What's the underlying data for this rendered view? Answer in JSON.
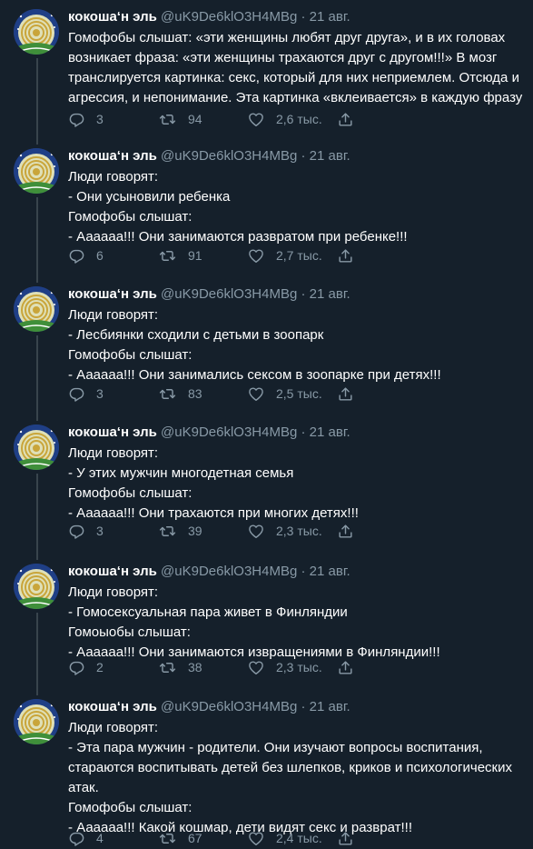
{
  "colors": {
    "background": "#15202b",
    "text": "#ffffff",
    "muted": "#8899a6",
    "thread_line": "#38444d"
  },
  "tweets": [
    {
      "author": "кокоша‘н эль",
      "handle": "@uK9De6klO3H4MBg",
      "separator": "·",
      "date": "21 авг.",
      "lines": [
        "Гомофобы слышат: «эти женщины любят друг друга», и в их головах возникает фраза: «эти женщины трахаются друг с другом!!!» В мозг транслируется картинка: секс, который для них неприемлем. Отсюда и агрессия, и непонимание. Эта картинка «вклеивается» в каждую фразу"
      ],
      "replies": "3",
      "retweets": "94",
      "likes": "2,6 тыс."
    },
    {
      "author": "кокоша‘н эль",
      "handle": "@uK9De6klO3H4MBg",
      "separator": "·",
      "date": "21 авг.",
      "lines": [
        "Люди говорят:",
        "- Они усыновили ребенка",
        "Гомофобы слышат:",
        "- Аааааа!!! Они занимаются развратом при ребенке!!!"
      ],
      "replies": "6",
      "retweets": "91",
      "likes": "2,7 тыс."
    },
    {
      "author": "кокоша‘н эль",
      "handle": "@uK9De6klO3H4MBg",
      "separator": "·",
      "date": "21 авг.",
      "lines": [
        "Люди говорят:",
        "- Лесбиянки сходили с детьми в зоопарк",
        "Гомофобы слышат:",
        "- Аааааа!!! Они занимались сексом в зоопарке при детях!!!"
      ],
      "replies": "3",
      "retweets": "83",
      "likes": "2,5 тыс."
    },
    {
      "author": "кокоша‘н эль",
      "handle": "@uK9De6klO3H4MBg",
      "separator": "·",
      "date": "21 авг.",
      "lines": [
        "Люди говорят:",
        "- У этих мужчин многодетная семья",
        "Гомофобы слышат:",
        "- Аааааа!!! Они трахаются при многих детях!!!"
      ],
      "replies": "3",
      "retweets": "39",
      "likes": "2,3 тыс."
    },
    {
      "author": "кокоша‘н эль",
      "handle": "@uK9De6klO3H4MBg",
      "separator": "·",
      "date": "21 авг.",
      "lines": [
        "Люди говорят:",
        "- Гомосексуальная пара живет в Финляндии",
        "Гомоыобы слышат:",
        "- Аааааа!!! Они занимаются извращениями в Финляндии!!!"
      ],
      "replies": "2",
      "retweets": "38",
      "likes": "2,3 тыс."
    },
    {
      "author": "кокоша‘н эль",
      "handle": "@uK9De6klO3H4MBg",
      "separator": "·",
      "date": "21 авг.",
      "lines": [
        "Люди говорят:",
        "- Эта пара мужчин - родители. Они изучают вопросы воспитания, стараются воспитывать детей без шлепков, криков и психологических атак.",
        "Гомофобы слышат:",
        "- Аааааа!!! Какой кошмар, дети видят секс и разврат!!!"
      ],
      "replies": "4",
      "retweets": "67",
      "likes": "2,4 тыс."
    }
  ],
  "icons": {
    "reply": "reply-icon",
    "retweet": "retweet-icon",
    "like": "heart-icon",
    "share": "share-icon",
    "avatar": "avatar-image"
  }
}
